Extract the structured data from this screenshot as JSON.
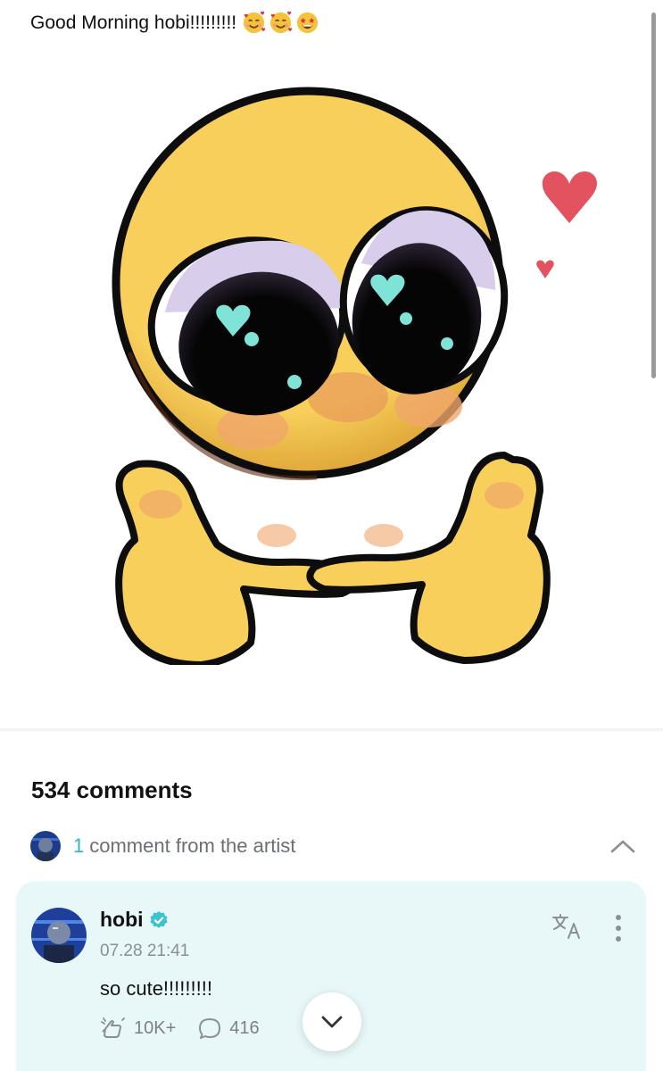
{
  "post": {
    "text": "Good Morning hobi!!!!!!!!!",
    "emojis": [
      "smiling-face-with-hearts-icon",
      "smiling-face-with-hearts-icon",
      "star-struck-icon"
    ]
  },
  "comments": {
    "count_label": "534 comments",
    "artist_count": "1",
    "artist_label": "comment from the artist"
  },
  "comment": {
    "author": "hobi",
    "time": "07.28 21:41",
    "body": "so cute!!!!!!!!!",
    "likes": "10K+",
    "replies": "416"
  },
  "colors": {
    "accent": "#2bb8c9",
    "card_bg": "#e8f8f8",
    "emoji_yellow": "#f7cf5a",
    "heart": "#e2525f",
    "eye_highlight": "#7fe3d8"
  }
}
